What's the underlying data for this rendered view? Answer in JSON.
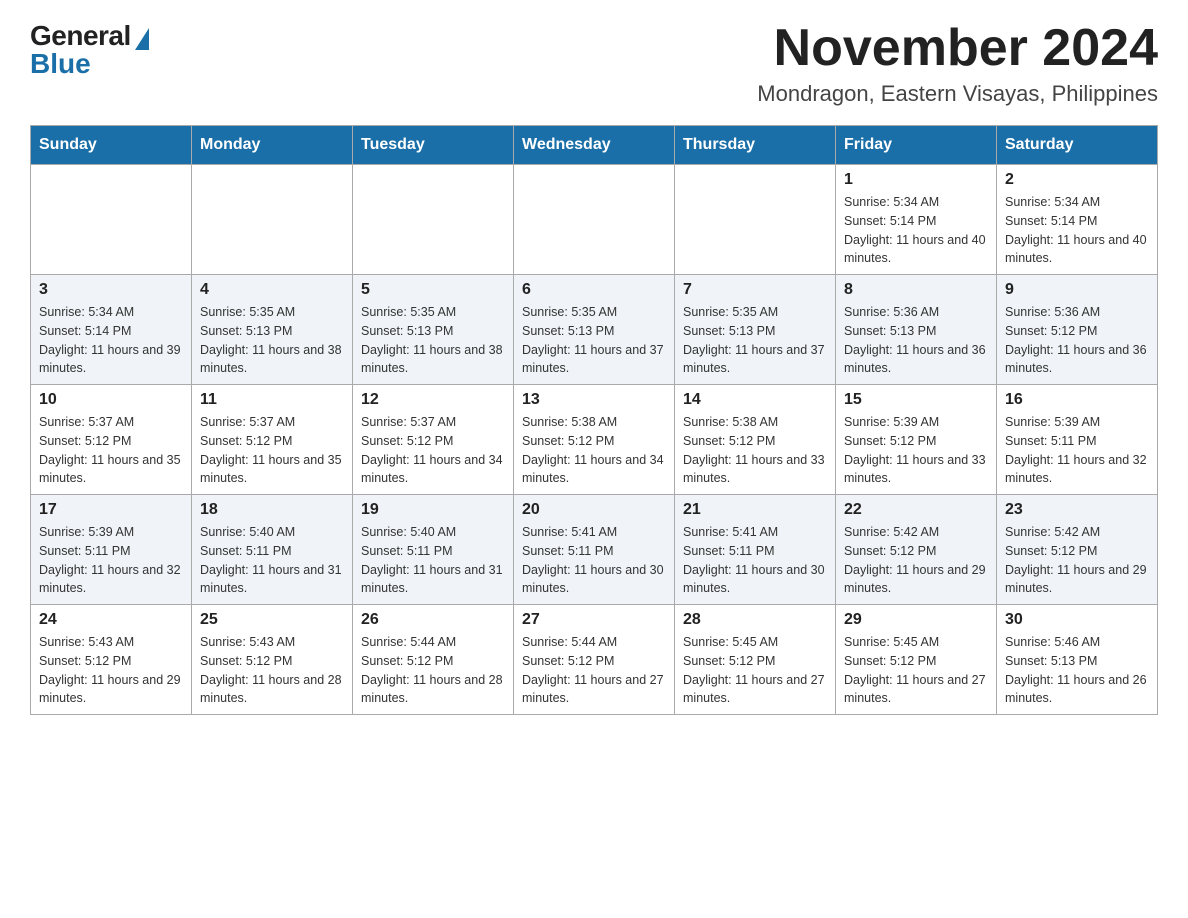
{
  "logo": {
    "general": "General",
    "blue": "Blue"
  },
  "title": "November 2024",
  "subtitle": "Mondragon, Eastern Visayas, Philippines",
  "days_of_week": [
    "Sunday",
    "Monday",
    "Tuesday",
    "Wednesday",
    "Thursday",
    "Friday",
    "Saturday"
  ],
  "weeks": [
    [
      {
        "day": "",
        "sunrise": "",
        "sunset": "",
        "daylight": ""
      },
      {
        "day": "",
        "sunrise": "",
        "sunset": "",
        "daylight": ""
      },
      {
        "day": "",
        "sunrise": "",
        "sunset": "",
        "daylight": ""
      },
      {
        "day": "",
        "sunrise": "",
        "sunset": "",
        "daylight": ""
      },
      {
        "day": "",
        "sunrise": "",
        "sunset": "",
        "daylight": ""
      },
      {
        "day": "1",
        "sunrise": "Sunrise: 5:34 AM",
        "sunset": "Sunset: 5:14 PM",
        "daylight": "Daylight: 11 hours and 40 minutes."
      },
      {
        "day": "2",
        "sunrise": "Sunrise: 5:34 AM",
        "sunset": "Sunset: 5:14 PM",
        "daylight": "Daylight: 11 hours and 40 minutes."
      }
    ],
    [
      {
        "day": "3",
        "sunrise": "Sunrise: 5:34 AM",
        "sunset": "Sunset: 5:14 PM",
        "daylight": "Daylight: 11 hours and 39 minutes."
      },
      {
        "day": "4",
        "sunrise": "Sunrise: 5:35 AM",
        "sunset": "Sunset: 5:13 PM",
        "daylight": "Daylight: 11 hours and 38 minutes."
      },
      {
        "day": "5",
        "sunrise": "Sunrise: 5:35 AM",
        "sunset": "Sunset: 5:13 PM",
        "daylight": "Daylight: 11 hours and 38 minutes."
      },
      {
        "day": "6",
        "sunrise": "Sunrise: 5:35 AM",
        "sunset": "Sunset: 5:13 PM",
        "daylight": "Daylight: 11 hours and 37 minutes."
      },
      {
        "day": "7",
        "sunrise": "Sunrise: 5:35 AM",
        "sunset": "Sunset: 5:13 PM",
        "daylight": "Daylight: 11 hours and 37 minutes."
      },
      {
        "day": "8",
        "sunrise": "Sunrise: 5:36 AM",
        "sunset": "Sunset: 5:13 PM",
        "daylight": "Daylight: 11 hours and 36 minutes."
      },
      {
        "day": "9",
        "sunrise": "Sunrise: 5:36 AM",
        "sunset": "Sunset: 5:12 PM",
        "daylight": "Daylight: 11 hours and 36 minutes."
      }
    ],
    [
      {
        "day": "10",
        "sunrise": "Sunrise: 5:37 AM",
        "sunset": "Sunset: 5:12 PM",
        "daylight": "Daylight: 11 hours and 35 minutes."
      },
      {
        "day": "11",
        "sunrise": "Sunrise: 5:37 AM",
        "sunset": "Sunset: 5:12 PM",
        "daylight": "Daylight: 11 hours and 35 minutes."
      },
      {
        "day": "12",
        "sunrise": "Sunrise: 5:37 AM",
        "sunset": "Sunset: 5:12 PM",
        "daylight": "Daylight: 11 hours and 34 minutes."
      },
      {
        "day": "13",
        "sunrise": "Sunrise: 5:38 AM",
        "sunset": "Sunset: 5:12 PM",
        "daylight": "Daylight: 11 hours and 34 minutes."
      },
      {
        "day": "14",
        "sunrise": "Sunrise: 5:38 AM",
        "sunset": "Sunset: 5:12 PM",
        "daylight": "Daylight: 11 hours and 33 minutes."
      },
      {
        "day": "15",
        "sunrise": "Sunrise: 5:39 AM",
        "sunset": "Sunset: 5:12 PM",
        "daylight": "Daylight: 11 hours and 33 minutes."
      },
      {
        "day": "16",
        "sunrise": "Sunrise: 5:39 AM",
        "sunset": "Sunset: 5:11 PM",
        "daylight": "Daylight: 11 hours and 32 minutes."
      }
    ],
    [
      {
        "day": "17",
        "sunrise": "Sunrise: 5:39 AM",
        "sunset": "Sunset: 5:11 PM",
        "daylight": "Daylight: 11 hours and 32 minutes."
      },
      {
        "day": "18",
        "sunrise": "Sunrise: 5:40 AM",
        "sunset": "Sunset: 5:11 PM",
        "daylight": "Daylight: 11 hours and 31 minutes."
      },
      {
        "day": "19",
        "sunrise": "Sunrise: 5:40 AM",
        "sunset": "Sunset: 5:11 PM",
        "daylight": "Daylight: 11 hours and 31 minutes."
      },
      {
        "day": "20",
        "sunrise": "Sunrise: 5:41 AM",
        "sunset": "Sunset: 5:11 PM",
        "daylight": "Daylight: 11 hours and 30 minutes."
      },
      {
        "day": "21",
        "sunrise": "Sunrise: 5:41 AM",
        "sunset": "Sunset: 5:11 PM",
        "daylight": "Daylight: 11 hours and 30 minutes."
      },
      {
        "day": "22",
        "sunrise": "Sunrise: 5:42 AM",
        "sunset": "Sunset: 5:12 PM",
        "daylight": "Daylight: 11 hours and 29 minutes."
      },
      {
        "day": "23",
        "sunrise": "Sunrise: 5:42 AM",
        "sunset": "Sunset: 5:12 PM",
        "daylight": "Daylight: 11 hours and 29 minutes."
      }
    ],
    [
      {
        "day": "24",
        "sunrise": "Sunrise: 5:43 AM",
        "sunset": "Sunset: 5:12 PM",
        "daylight": "Daylight: 11 hours and 29 minutes."
      },
      {
        "day": "25",
        "sunrise": "Sunrise: 5:43 AM",
        "sunset": "Sunset: 5:12 PM",
        "daylight": "Daylight: 11 hours and 28 minutes."
      },
      {
        "day": "26",
        "sunrise": "Sunrise: 5:44 AM",
        "sunset": "Sunset: 5:12 PM",
        "daylight": "Daylight: 11 hours and 28 minutes."
      },
      {
        "day": "27",
        "sunrise": "Sunrise: 5:44 AM",
        "sunset": "Sunset: 5:12 PM",
        "daylight": "Daylight: 11 hours and 27 minutes."
      },
      {
        "day": "28",
        "sunrise": "Sunrise: 5:45 AM",
        "sunset": "Sunset: 5:12 PM",
        "daylight": "Daylight: 11 hours and 27 minutes."
      },
      {
        "day": "29",
        "sunrise": "Sunrise: 5:45 AM",
        "sunset": "Sunset: 5:12 PM",
        "daylight": "Daylight: 11 hours and 27 minutes."
      },
      {
        "day": "30",
        "sunrise": "Sunrise: 5:46 AM",
        "sunset": "Sunset: 5:13 PM",
        "daylight": "Daylight: 11 hours and 26 minutes."
      }
    ]
  ]
}
